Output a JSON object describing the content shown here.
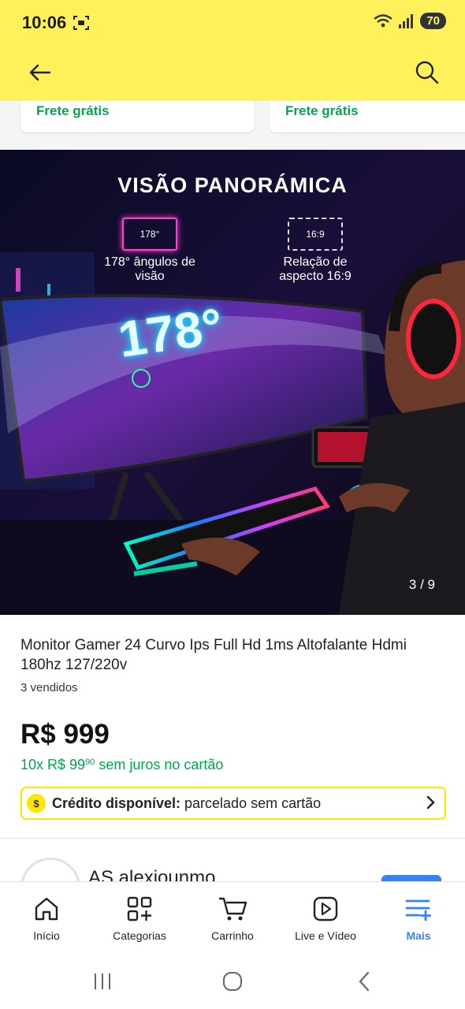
{
  "status_bar": {
    "time": "10:06",
    "battery": "70"
  },
  "header": {
    "back_icon": "arrow-left-icon",
    "search_icon": "search-icon",
    "background_color": "#fff159"
  },
  "shipping_cards": [
    {
      "label": "Frete grátis"
    },
    {
      "label": "Frete grátis"
    }
  ],
  "product_image": {
    "headline": "VISÃO PANORÁMICA",
    "angle_badge_box": "178°",
    "angle_badge_text": "178° ângulos de visão",
    "ratio_badge_box": "16:9",
    "ratio_badge_text": "Relação de aspecto 16:9",
    "big_angle": "178°",
    "counter": "3 / 9"
  },
  "product": {
    "title": "Monitor Gamer 24  Curvo Ips Full Hd 1ms Altofalante Hdmi 180hz 127/220v",
    "sold": "3 vendidos",
    "price": "R$ 999",
    "installments_prefix": "10x R$ 99",
    "installments_cents": "90",
    "installments_suffix": " sem juros no cartão",
    "credit_label": "Crédito disponível:",
    "credit_value": " parcelado sem cartão",
    "accent_green": "#00a650"
  },
  "seller": {
    "name": "AS alexiounmo"
  },
  "bottom_nav": {
    "items": [
      {
        "label": "Início",
        "icon": "home-icon"
      },
      {
        "label": "Categorias",
        "icon": "categories-icon"
      },
      {
        "label": "Carrinho",
        "icon": "cart-icon"
      },
      {
        "label": "Live e Vídeo",
        "icon": "video-play-icon"
      },
      {
        "label": "Mais",
        "icon": "menu-plus-icon",
        "active": true
      }
    ],
    "active_color": "#3483fa"
  }
}
